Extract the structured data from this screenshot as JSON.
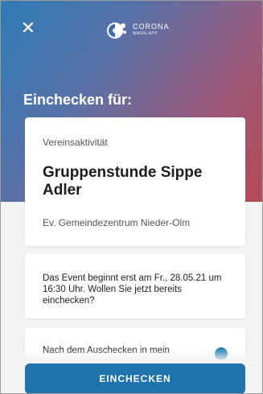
{
  "header": {
    "close_icon": "close-icon",
    "logo_name": "CORONA",
    "logo_sub": "WARN APP",
    "title": "Einchecken für:"
  },
  "event": {
    "type": "Vereinsaktivität",
    "name": "Gruppenstunde Sippe Adler",
    "location": "Ev. Gemeindezentrum Nieder-Olm"
  },
  "info": {
    "text": "Das Event beginnt erst am Fr., 28.05.21 um 16:30 Uhr. Wollen Sie jetzt bereits einchecken?"
  },
  "checkout": {
    "text": "Nach dem Auschecken in mein"
  },
  "actions": {
    "checkin_label": "EINCHECKEN"
  },
  "colors": {
    "primary": "#1f73ad",
    "gradient_start": "#2e7bb6",
    "gradient_end": "#b64a55"
  }
}
